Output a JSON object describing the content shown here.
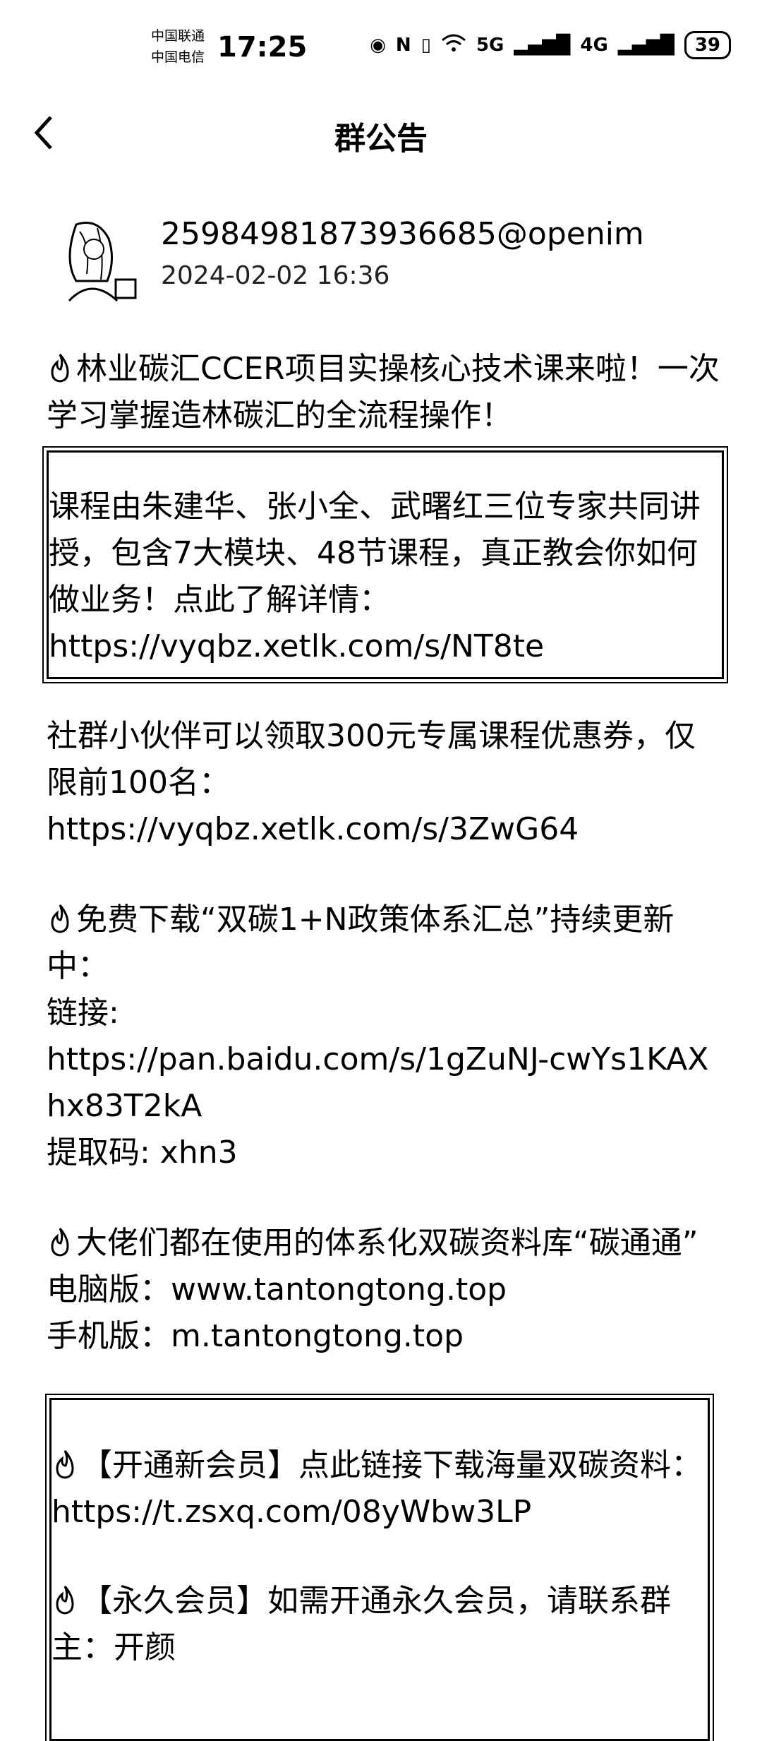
{
  "status_bar": {
    "carrier_1": "中国联通",
    "carrier_2": "中国电信",
    "time": "17:25",
    "battery": "39",
    "network_1": "5G",
    "network_2": "4G"
  },
  "header": {
    "title": "群公告",
    "back_icon": "chevron-left-icon"
  },
  "post": {
    "author": "25984981873936685@openim",
    "date": "2024-02-02 16:36"
  },
  "content": {
    "p1": "林业碳汇CCER项目实操核心技术课来啦！一次学习掌握造林碳汇的全流程操作！",
    "box1": "课程由朱建华、张小全、武曙红三位专家共同讲授，包含7大模块、48节课程，真正教会你如何做业务！点此了解详情：",
    "box1_link": "https://vyqbz.xetlk.com/s/NT8te",
    "p2": "社群小伙伴可以领取300元专属课程优惠券，仅限前100名：",
    "p2_link": "https://vyqbz.xetlk.com/s/3ZwG64",
    "p3": "免费下载“双碳1+N政策体系汇总”持续更新中：",
    "p3_label": "链接:",
    "p3_link": "https://pan.baidu.com/s/1gZuNJ-cwYs1KAXhx83T2kA",
    "p3_code": "提取码: xhn3",
    "p4": "大佬们都在使用的体系化双碳资料库“碳通通”",
    "p4_pc": "电脑版：www.tantongtong.top",
    "p4_mobile": "手机版：m.tantongtong.top",
    "box2_a": "【开通新会员】点此链接下载海量双碳资料：https://t.zsxq.com/08yWbw3LP",
    "box2_b": "【永久会员】如需开通永久会员，请联系群主：开颜"
  },
  "icons": [
    "eye-icon",
    "nfc-icon",
    "vibrate-icon",
    "wifi-icon",
    "signal-icon",
    "battery-icon",
    "fire-icon"
  ]
}
